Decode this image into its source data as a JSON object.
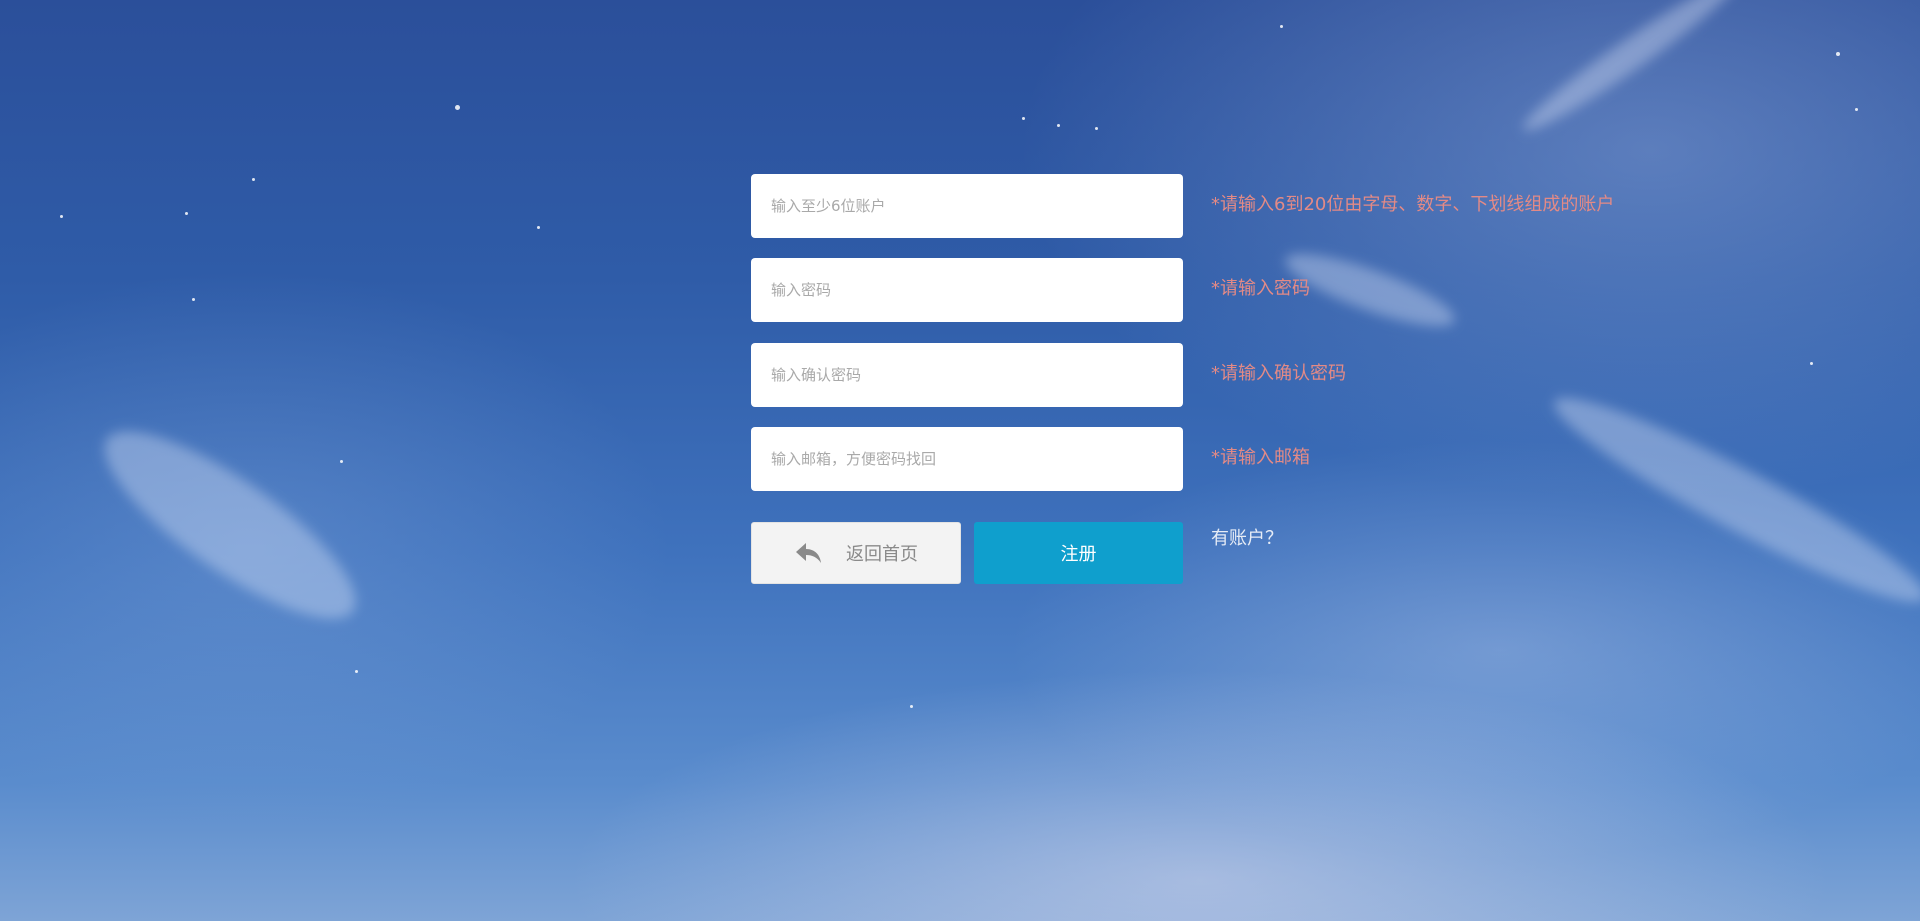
{
  "form": {
    "account": {
      "placeholder": "输入至少6位账户",
      "hint": "*请输入6到20位由字母、数字、下划线组成的账户"
    },
    "password": {
      "placeholder": "输入密码",
      "hint": "*请输入密码"
    },
    "confirm_password": {
      "placeholder": "输入确认密码",
      "hint": "*请输入确认密码"
    },
    "email": {
      "placeholder": "输入邮箱，方便密码找回",
      "hint": "*请输入邮箱"
    }
  },
  "actions": {
    "back_label": "返回首页",
    "back_icon": "reply-arrow-icon",
    "register_label": "注册",
    "login_link": "有账户？"
  },
  "colors": {
    "hint": "#e38a86",
    "register_button": "#0f9fcd",
    "back_button": "#f3f3f3"
  }
}
